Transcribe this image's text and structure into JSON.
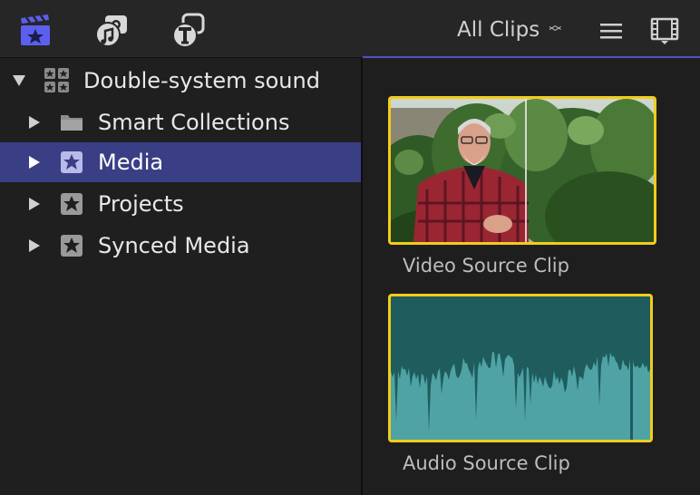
{
  "toolbar": {
    "icons": [
      {
        "name": "libraries-icon",
        "active": true
      },
      {
        "name": "photos-audio-icon",
        "active": false
      },
      {
        "name": "titles-generators-icon",
        "active": false
      }
    ],
    "filter_label": "All Clips",
    "right_icons": [
      "list-view-icon",
      "filmstrip-view-icon"
    ],
    "accent_color": "#5a5ff0"
  },
  "sidebar": {
    "library": {
      "label": "Double-system sound",
      "icon": "library-icon",
      "expanded": true
    },
    "items": [
      {
        "label": "Smart Collections",
        "icon": "folder-icon",
        "selected": false
      },
      {
        "label": "Media",
        "icon": "star-icon",
        "selected": true
      },
      {
        "label": "Projects",
        "icon": "star-icon",
        "selected": false
      },
      {
        "label": "Synced Media",
        "icon": "star-icon",
        "selected": false
      }
    ],
    "selection_color": "#3a3e85"
  },
  "browser": {
    "clips": [
      {
        "name": "Video Source Clip",
        "type": "video"
      },
      {
        "name": "Audio Source Clip",
        "type": "audio"
      }
    ],
    "selection_border_color": "#f2cc1a",
    "waveform_color": "#4fa3a5"
  }
}
